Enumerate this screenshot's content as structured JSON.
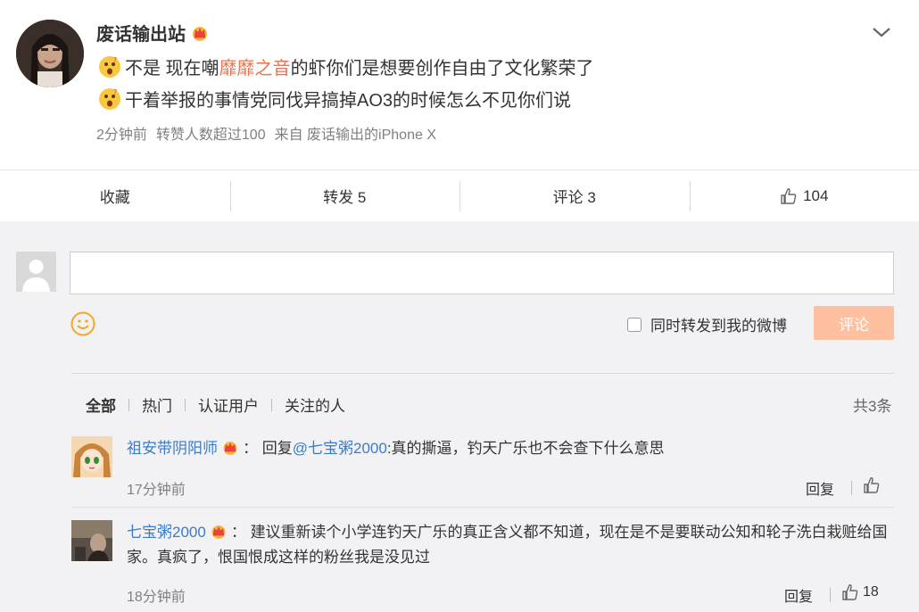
{
  "post": {
    "username": "废话输出站",
    "line1_prefix": "不是 现在嘲",
    "line1_link": "靡靡之音",
    "line1_suffix": "的虾你们是想要创作自由了文化繁荣了",
    "line2": "干着举报的事情党同伐异搞掉AO3的时候怎么不见你们说",
    "time": "2分钟前",
    "reposts_note": "转赞人数超过100",
    "source": "来自 废话输出的iPhone X"
  },
  "actions": {
    "favorite": "收藏",
    "repost": "转发 5",
    "comment": "评论 3",
    "like": "104"
  },
  "composer": {
    "input_value": "",
    "sync_label": "同时转发到我的微博",
    "submit_label": "评论"
  },
  "filters": {
    "all": "全部",
    "hot": "热门",
    "verified": "认证用户",
    "following": "关注的人",
    "count": "共3条"
  },
  "comments": [
    {
      "user": "祖安带阴阳师",
      "colon": "：",
      "text_prefix": "回复",
      "mention": "@七宝粥2000",
      "text": ":真的撕逼，钓天广乐也不会查下什么意思",
      "time": "17分钟前",
      "reply": "回复",
      "likes": ""
    },
    {
      "user": "七宝粥2000",
      "colon": "：",
      "text": "建议重新读个小学连钓天广乐的真正含义都不知道，现在是不是要联动公知和轮子洗白栽赃给国家。真疯了，恨国恨成这样的粉丝我是没见过",
      "time": "18分钟前",
      "reply": "回复",
      "likes": "18"
    }
  ],
  "icons": {
    "crown": "crown-icon",
    "emoji": "surprised-face-icon",
    "thumb": "thumbs-up-icon",
    "chevron": "chevron-down-icon",
    "smiley": "smiley-icon"
  },
  "colors": {
    "link_red": "#eb7350",
    "link_blue": "#3b7cc7",
    "submit_bg": "#ffc09f",
    "crown_red": "#e8423f",
    "crown_gold": "#f7b733"
  }
}
